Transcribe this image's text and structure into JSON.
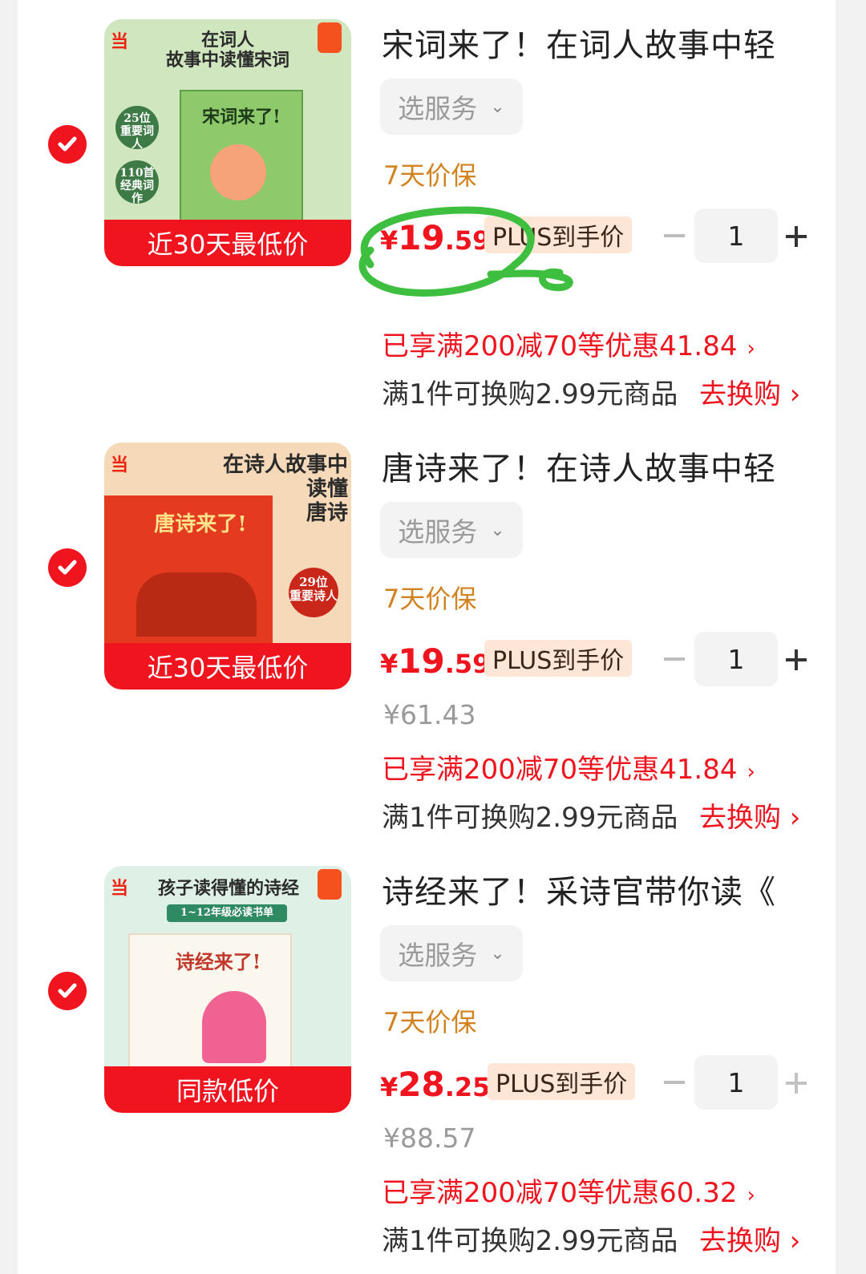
{
  "colors": {
    "accent": "#f0141f",
    "plus_bg": "#fde6d6",
    "guarantee": "#d2821f",
    "annotation": "#3fbf3f"
  },
  "items": [
    {
      "cover_headline": "在词人\n故事中读懂宋词",
      "cover_book_title": "宋词来了!",
      "cover_note_a": "25位\n重要词人",
      "cover_note_b": "110首\n经典词作",
      "badge": "近30天最低价",
      "title": "宋词来了！在词人故事中轻",
      "service": "选服务",
      "guarantee": "7天价保",
      "price_currency": "¥",
      "price_int": "19",
      "price_dec": ".59",
      "plus_label": "PLUS到手价",
      "quantity": "1",
      "promo": "已享满200减70等优惠41.84",
      "swap": "满1件可换购2.99元商品",
      "swap_link": "去换购 ›"
    },
    {
      "cover_headline": "在诗人故事中\n读懂\n唐诗",
      "cover_book_title": "唐诗来了!",
      "cover_note_a": "29位\n重要诗人",
      "badge": "近30天最低价",
      "title": "唐诗来了！在诗人故事中轻",
      "service": "选服务",
      "guarantee": "7天价保",
      "price_currency": "¥",
      "price_int": "19",
      "price_dec": ".59",
      "plus_label": "PLUS到手价",
      "quantity": "1",
      "original_price": "¥61.43",
      "promo": "已享满200减70等优惠41.84",
      "swap": "满1件可换购2.99元商品",
      "swap_link": "去换购 ›"
    },
    {
      "cover_headline": "孩子读得懂的诗经",
      "cover_sub": "1~12年级必读书单",
      "cover_book_title": "诗经来了!",
      "badge": "同款低价",
      "title": "诗经来了！采诗官带你读《",
      "service": "选服务",
      "guarantee": "7天价保",
      "price_currency": "¥",
      "price_int": "28",
      "price_dec": ".25",
      "plus_label": "PLUS到手价",
      "quantity": "1",
      "original_price": "¥88.57",
      "promo": "已享满200减70等优惠60.32",
      "swap": "满1件可换购2.99元商品",
      "swap_link": "去换购 ›"
    }
  ]
}
